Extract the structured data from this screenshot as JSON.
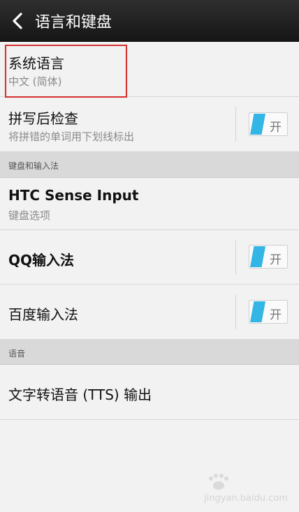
{
  "header": {
    "title": "语言和键盘"
  },
  "items": {
    "system_language": {
      "title": "系统语言",
      "subtitle": "中文 (简体)"
    },
    "spell_check": {
      "title": "拼写后检查",
      "subtitle": "将拼错的单词用下划线标出",
      "toggle": "开"
    },
    "section_keyboard": "键盘和输入法",
    "htc_sense": {
      "title": "HTC Sense Input",
      "subtitle": "键盘选项"
    },
    "qq_input": {
      "title": "QQ输入法",
      "toggle": "开"
    },
    "baidu_input": {
      "title": "百度输入法",
      "toggle": "开"
    },
    "section_speech": "语音",
    "tts": {
      "title": "文字转语音 (TTS) 输出"
    }
  },
  "colors": {
    "header_bg": "#1b1b1b",
    "toggle_on": "#33b5e5",
    "highlight": "#d32f2f",
    "section_bg": "#d9d9d9"
  },
  "watermark": {
    "text": "jingyan.baidu.com"
  }
}
